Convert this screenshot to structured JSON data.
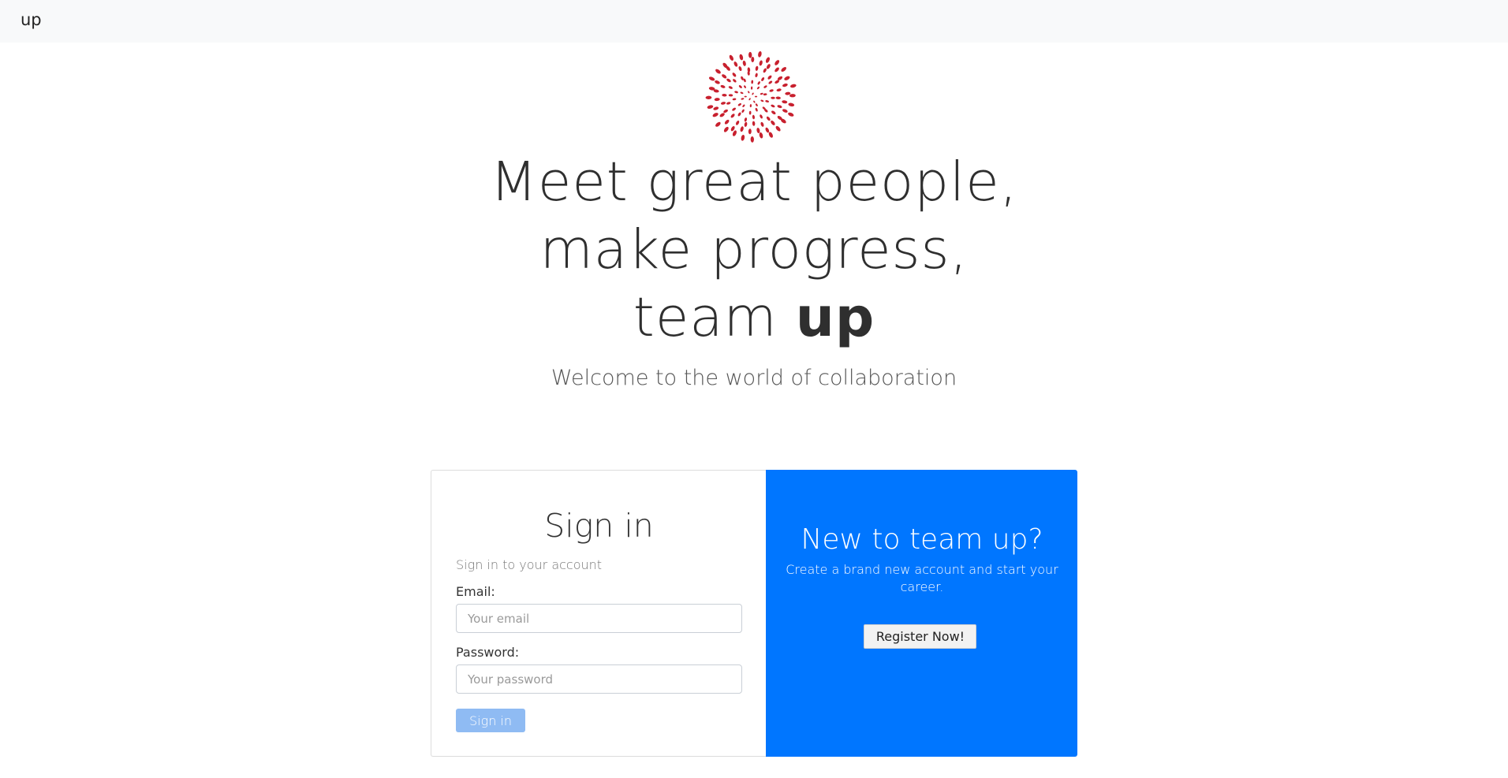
{
  "navbar": {
    "brand": "up"
  },
  "hero": {
    "line1": "Meet great people,",
    "line2": "make progress,",
    "line3_prefix": "team",
    "line3_bold": "up",
    "subtitle": "Welcome to the world of collaboration"
  },
  "signin": {
    "title": "Sign in",
    "subtitle": "Sign in to your account",
    "email_label": "Email:",
    "email_placeholder": "Your email",
    "email_value": "",
    "password_label": "Password:",
    "password_placeholder": "Your password",
    "password_value": "",
    "button_label": "Sign in"
  },
  "register": {
    "title": "New to team up?",
    "description": "Create a brand new account and start your career.",
    "button_label": "Register Now!"
  },
  "colors": {
    "accent": "#0076ff",
    "logo_red": "#c8202e",
    "signin_button": "#8fbbf3",
    "navbar_bg": "#f8f9fa"
  },
  "icons": {
    "logo": "red-dot-burst-logo"
  }
}
